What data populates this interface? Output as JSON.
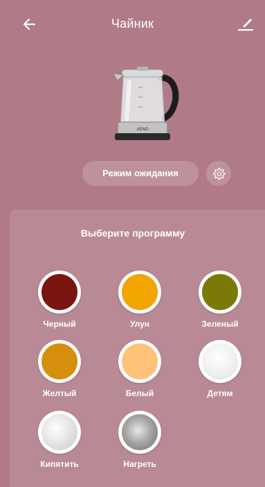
{
  "header": {
    "title": "Чайник",
    "back_icon": "arrow-left-icon",
    "edit_icon": "pencil-icon"
  },
  "device": {
    "image": "kettle-image",
    "brand_text": "AENO"
  },
  "mode": {
    "label": "Режим ожидания",
    "settings_icon": "gear-icon"
  },
  "panel": {
    "title": "Выберите программу"
  },
  "programs": [
    {
      "label": "Черный",
      "color": "#7a1510"
    },
    {
      "label": "Улун",
      "color": "#f2a500"
    },
    {
      "label": "Зеленый",
      "color": "#7b7a08"
    },
    {
      "label": "Желтый",
      "color": "#d68f0c"
    },
    {
      "label": "Белый",
      "color": "#ffc27a"
    },
    {
      "label": "Детям",
      "color": "#eeeeee"
    },
    {
      "label": "Кипятить",
      "color": "#dcdcdc"
    },
    {
      "label": "Нагреть",
      "color": "#9a9a9a"
    }
  ],
  "colors": {
    "background": "#b07a86",
    "panel": "#b98a95"
  }
}
